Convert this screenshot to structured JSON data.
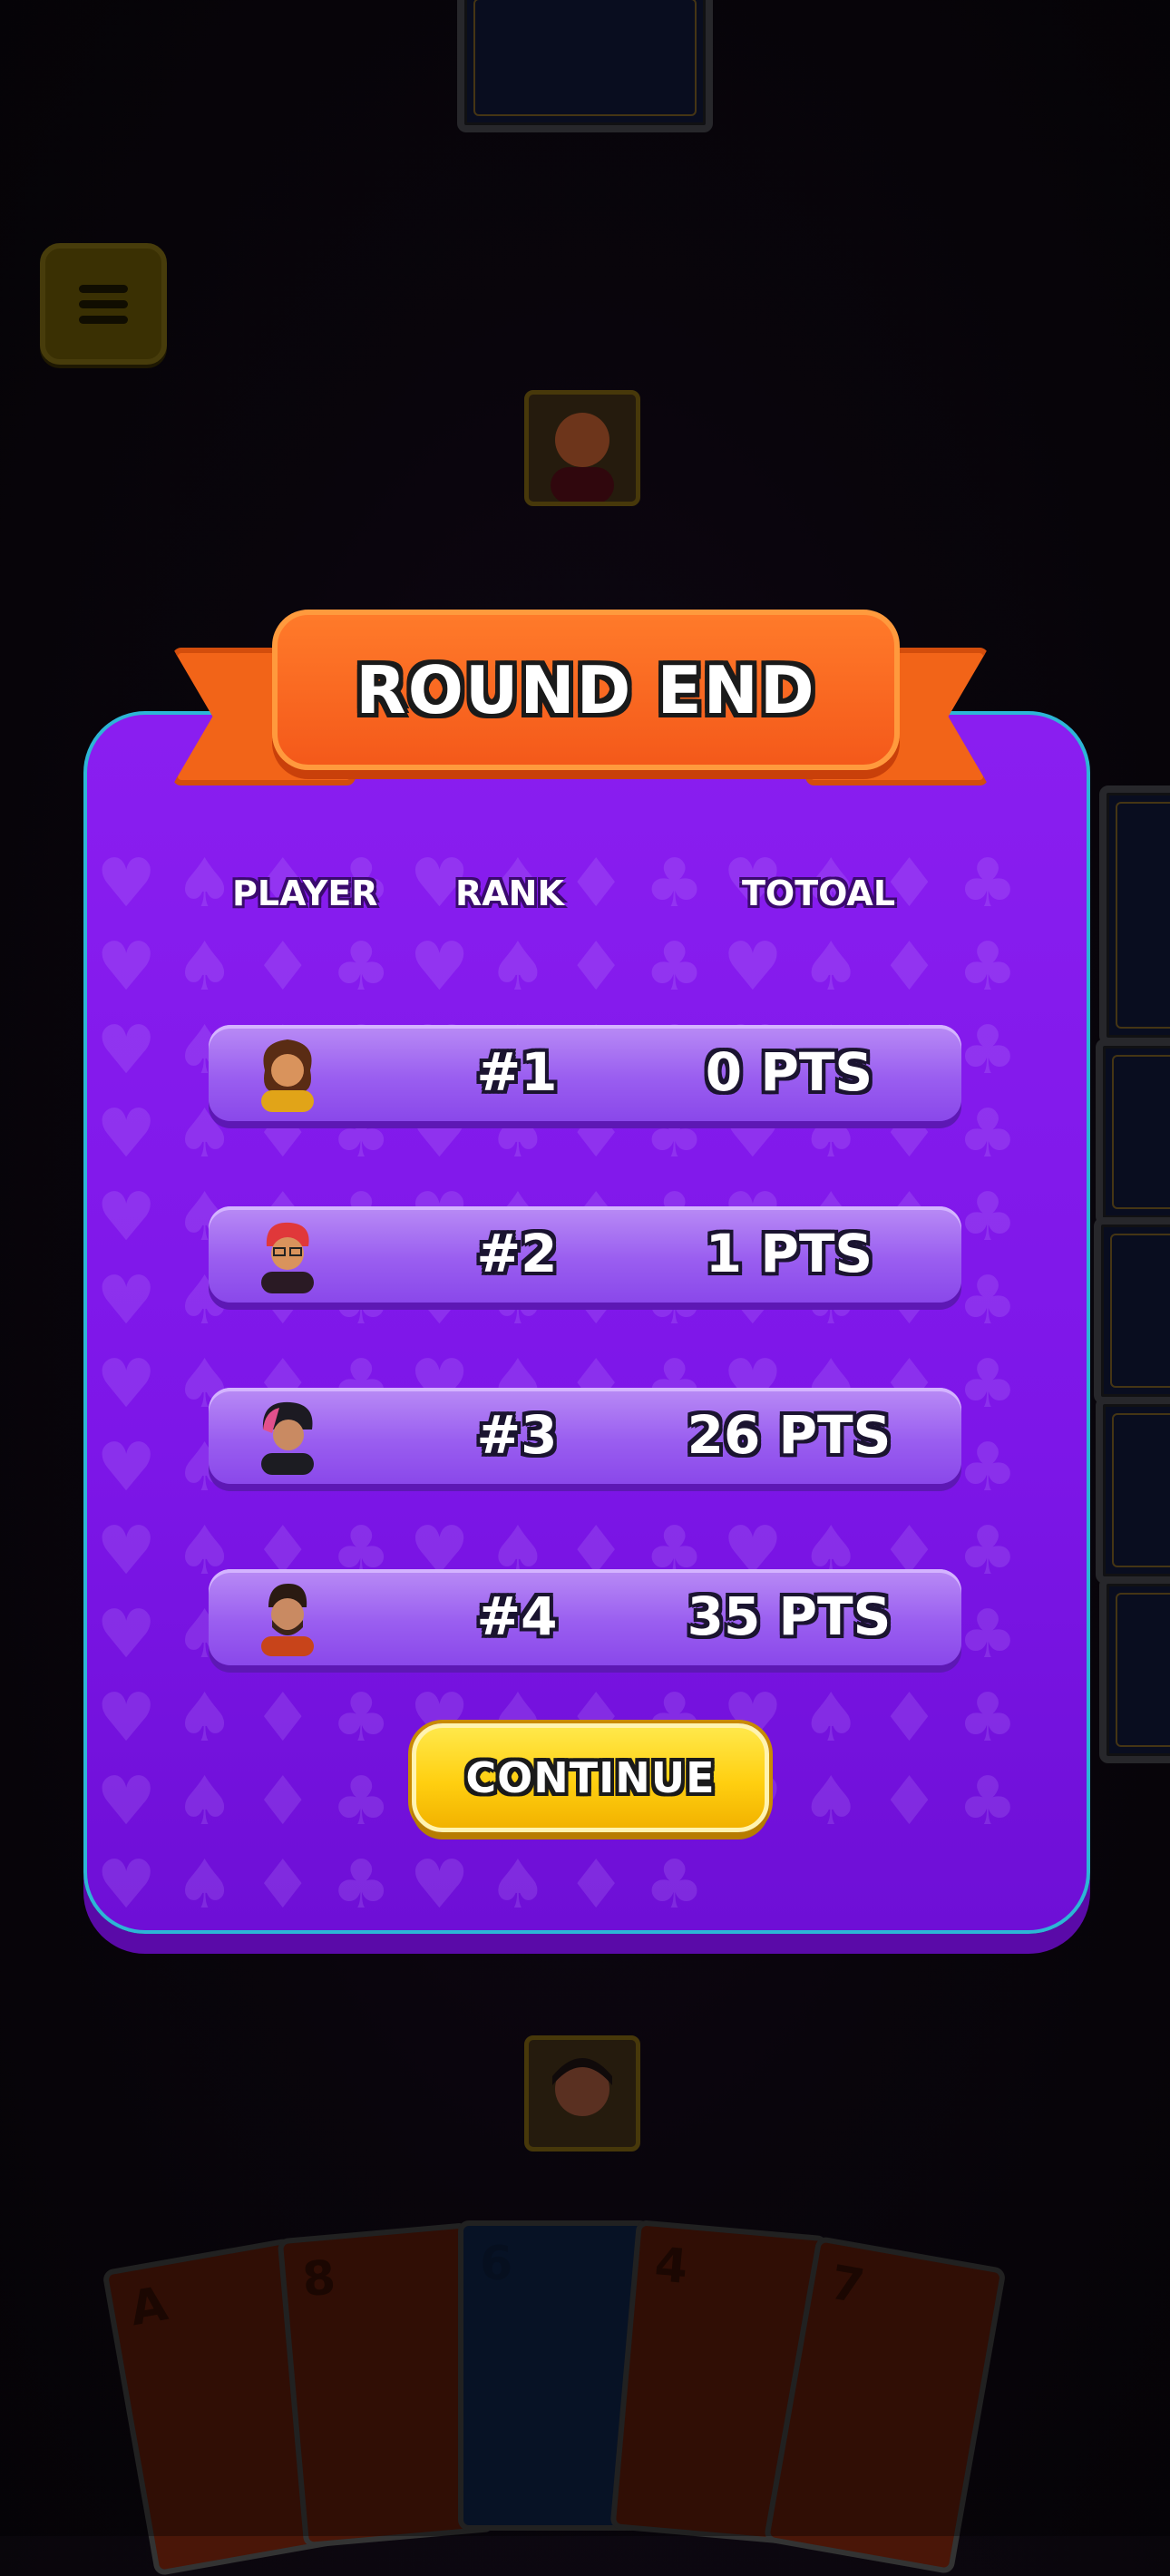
{
  "modal": {
    "title": "ROUND END",
    "headers": {
      "player": "PLAYER",
      "rank": "RANK",
      "total": "TOTOAL"
    },
    "rows": [
      {
        "rank": "#1",
        "points": "0 PTS",
        "avatar": "avatar-girl-curly-hair"
      },
      {
        "rank": "#2",
        "points": "1 PTS",
        "avatar": "avatar-red-hair-glasses"
      },
      {
        "rank": "#3",
        "points": "26 PTS",
        "avatar": "avatar-pink-streak-hair"
      },
      {
        "rank": "#4",
        "points": "35 PTS",
        "avatar": "avatar-beard-glasses"
      }
    ],
    "continue_label": "CONTINUE"
  },
  "hand": {
    "cards": [
      "A",
      "8",
      "6",
      "4",
      "7"
    ]
  },
  "colors": {
    "modal": "#7d16e8",
    "banner": "#f4591a",
    "button": "#ffcf10",
    "row": "#9a5ef0"
  }
}
